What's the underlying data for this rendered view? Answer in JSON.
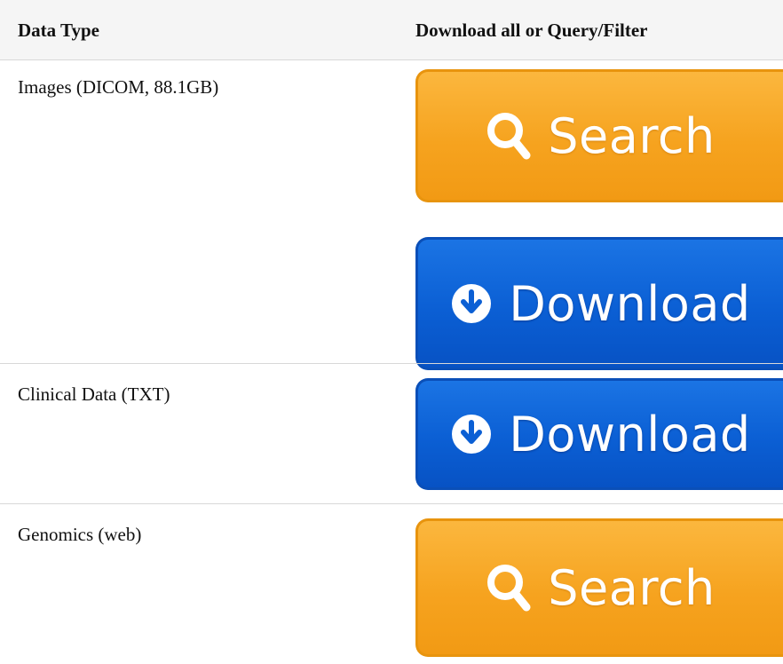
{
  "header": {
    "col1": "Data Type",
    "col2": "Download all or Query/Filter"
  },
  "rows": [
    {
      "label": "Images (DICOM, 88.1GB)",
      "buttons": [
        "Search",
        "Download"
      ]
    },
    {
      "label": "Clinical Data (TXT)",
      "buttons": [
        "Download"
      ]
    },
    {
      "label": "Genomics (web)",
      "buttons": [
        "Search"
      ]
    }
  ],
  "icons": {
    "search": "search-icon",
    "download": "download-icon"
  },
  "colors": {
    "search_orange": "#f6a31f",
    "download_blue": "#0b5fd4",
    "header_bg": "#f5f5f5"
  }
}
